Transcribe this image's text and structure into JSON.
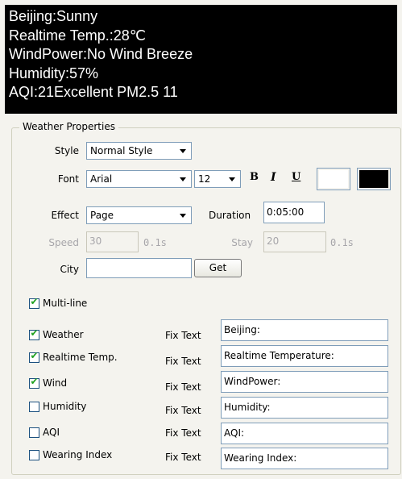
{
  "preview": {
    "lines": [
      "Beijing:Sunny",
      "Realtime Temp.:28℃",
      "WindPower:No Wind Breeze",
      "Humidity:57%",
      "AQI:21Excellent  PM2.5 11"
    ]
  },
  "group_title": "Weather Properties",
  "style": {
    "label": "Style",
    "value": "Normal Style"
  },
  "font": {
    "label": "Font",
    "family": "Arial",
    "size": "12",
    "bold": "B",
    "italic": "I",
    "underline": "U",
    "bg_color": "#ffffff",
    "fg_color": "#000000"
  },
  "effect": {
    "label": "Effect",
    "value": "Page",
    "duration_label": "Duration",
    "duration_value": "0:05:00"
  },
  "speed": {
    "label": "Speed",
    "value": "30",
    "unit": "0.1s"
  },
  "stay": {
    "label": "Stay",
    "value": "20",
    "unit": "0.1s"
  },
  "city": {
    "label": "City",
    "value": "",
    "get_label": "Get"
  },
  "multiline": {
    "label": "Multi-line",
    "checked": true
  },
  "fix_text_label": "Fix Text",
  "items": [
    {
      "label": "Weather",
      "checked": true,
      "fix_text": "Beijing:"
    },
    {
      "label": "Realtime Temp.",
      "checked": true,
      "fix_text": "Realtime Temperature:"
    },
    {
      "label": "Wind",
      "checked": true,
      "fix_text": "WindPower:"
    },
    {
      "label": "Humidity",
      "checked": false,
      "fix_text": "Humidity:"
    },
    {
      "label": "AQI",
      "checked": false,
      "fix_text": "AQI:"
    },
    {
      "label": "Wearing Index",
      "checked": false,
      "fix_text": "Wearing Index:"
    }
  ]
}
